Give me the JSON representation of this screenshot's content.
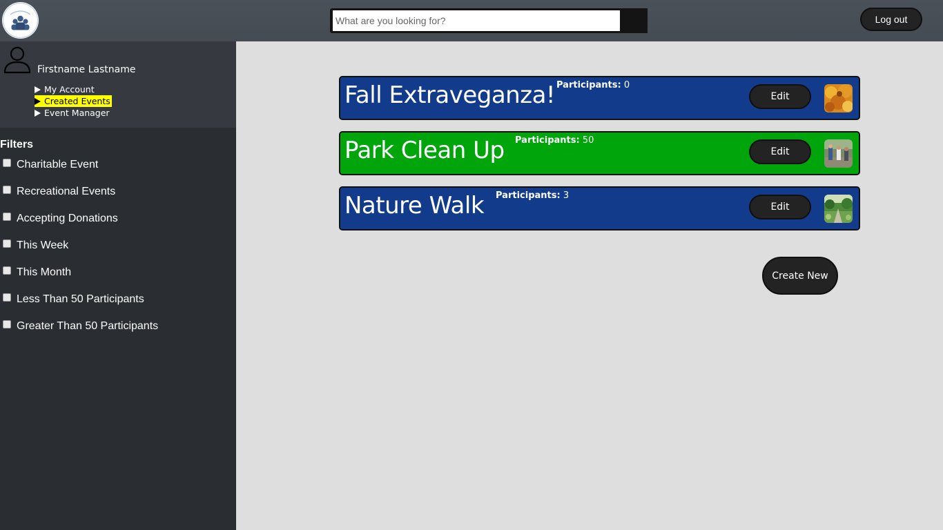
{
  "header": {
    "search": {
      "placeholder": "What are you looking for?",
      "value": ""
    },
    "logout_label": "Log out",
    "logo_icon": "community-logo-icon"
  },
  "sidebar": {
    "user": {
      "name": "Firstname Lastname",
      "avatar_icon": "user-outline-icon"
    },
    "nav": [
      {
        "label": "My Account",
        "active": false
      },
      {
        "label": "Created Events",
        "active": true
      },
      {
        "label": "Event Manager",
        "active": false
      }
    ],
    "filters_title": "Filters",
    "filters": [
      {
        "label": "Charitable Event",
        "checked": false
      },
      {
        "label": "Recreational Events",
        "checked": false
      },
      {
        "label": "Accepting Donations",
        "checked": false
      },
      {
        "label": "This Week",
        "checked": false
      },
      {
        "label": "This Month",
        "checked": false
      },
      {
        "label": "Less Than 50 Participants",
        "checked": false
      },
      {
        "label": "Greater Than 50 Participants",
        "checked": false
      }
    ]
  },
  "events": [
    {
      "title": "Fall Extraveganza!",
      "participants_label": "Participants:",
      "participants": "0",
      "edit_label": "Edit",
      "color": "#123c8b",
      "thumb": "autumn-leaves-thumbnail"
    },
    {
      "title": "Park Clean Up",
      "participants_label": "Participants:",
      "participants": "50",
      "edit_label": "Edit",
      "color": "#00a50c",
      "thumb": "park-cleanup-thumbnail"
    },
    {
      "title": "Nature Walk",
      "participants_label": "Participants:",
      "participants": "3",
      "edit_label": "Edit",
      "color": "#123c8b",
      "thumb": "nature-garden-thumbnail"
    }
  ],
  "create_label": "Create New",
  "colors": {
    "header": "#4b5158",
    "sidebar": "#2a2d31",
    "profile": "#363a40",
    "main": "#dedede",
    "active_nav": "#ffff00",
    "button": "#232323"
  }
}
